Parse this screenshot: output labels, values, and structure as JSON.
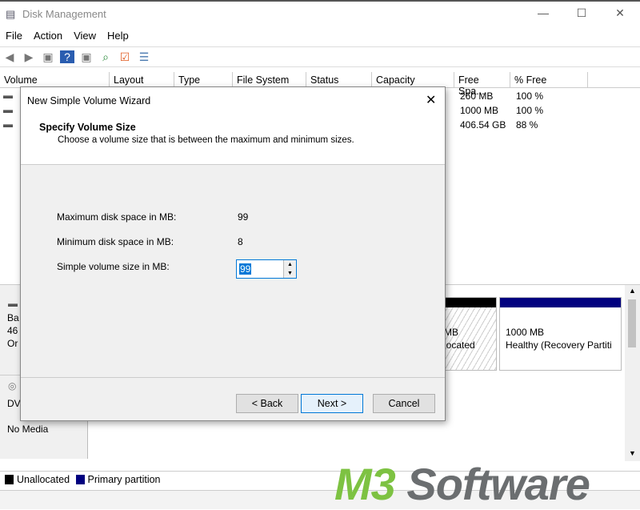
{
  "window": {
    "title": "Disk Management",
    "minimize": "—",
    "maximize": "☐",
    "close": "✕"
  },
  "menu": [
    "File",
    "Action",
    "View",
    "Help"
  ],
  "columns": [
    "Volume",
    "Layout",
    "Type",
    "File System",
    "Status",
    "Capacity",
    "Free Spa...",
    "% Free"
  ],
  "rows": [
    {
      "free": "260 MB",
      "pct": "100 %"
    },
    {
      "free": "1000 MB",
      "pct": "100 %"
    },
    {
      "free": "406.54 GB",
      "pct": "88 %"
    }
  ],
  "disks": {
    "disk0_labels": [
      "Ba",
      "46",
      "Or"
    ],
    "unalloc_size": "MB",
    "unalloc_label": "located",
    "recovery_size": "1000 MB",
    "recovery_label": "Healthy (Recovery Partiti",
    "dvd_label": "DV",
    "dvd_status": "No Media"
  },
  "legend": [
    {
      "label": "Unallocated",
      "color": "#000000"
    },
    {
      "label": "Primary partition",
      "color": "#00007f"
    }
  ],
  "dialog": {
    "title": "New Simple Volume Wizard",
    "heading": "Specify Volume Size",
    "subheading": "Choose a volume size that is between the maximum and minimum sizes.",
    "max_label": "Maximum disk space in MB:",
    "max_value": "99",
    "min_label": "Minimum disk space in MB:",
    "min_value": "8",
    "size_label": "Simple volume size in MB:",
    "size_value": "99",
    "back": "< Back",
    "next": "Next >",
    "cancel": "Cancel"
  },
  "watermark": {
    "m3": "M3",
    "software": "Software"
  }
}
